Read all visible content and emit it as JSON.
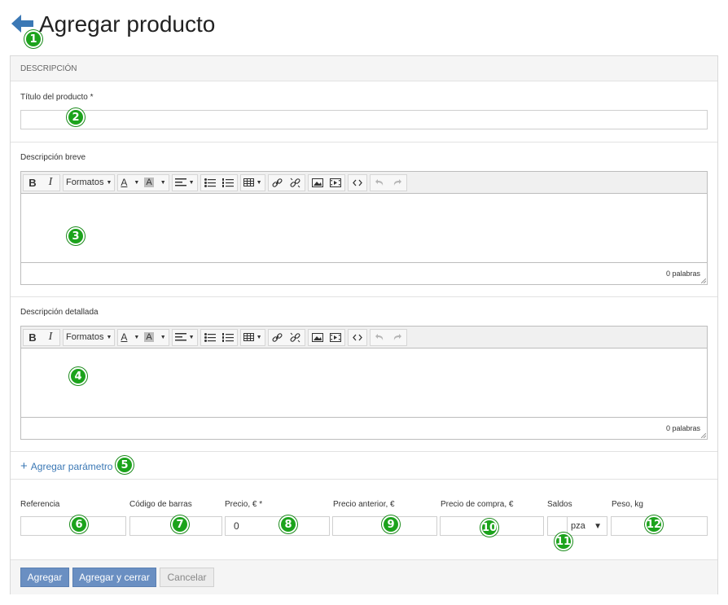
{
  "header": {
    "title": "Agregar producto"
  },
  "panel": {
    "heading": "DESCRIPCIÓN"
  },
  "product_title": {
    "label": "Título del producto *",
    "value": ""
  },
  "short_description": {
    "label": "Descripción breve",
    "word_count": "0 palabras"
  },
  "long_description": {
    "label": "Descripción detallada",
    "word_count": "0 palabras"
  },
  "toolbar": {
    "formats_label": "Formatos",
    "font_color_glyph": "A",
    "bg_color_glyph": "A"
  },
  "add_parameter": {
    "label": "Agregar parámetro"
  },
  "fields": {
    "reference": {
      "label": "Referencia",
      "value": ""
    },
    "barcode": {
      "label": "Código de barras",
      "value": ""
    },
    "price": {
      "label": "Precio, € *",
      "value": "0"
    },
    "old_price": {
      "label": "Precio anterior, €",
      "value": ""
    },
    "purchase_price": {
      "label": "Precio de compra, €",
      "value": ""
    },
    "stock": {
      "label": "Saldos",
      "value": "",
      "unit": "pza"
    },
    "weight": {
      "label": "Peso, kg",
      "value": ""
    }
  },
  "buttons": {
    "add": "Agregar",
    "add_close": "Agregar y cerrar",
    "cancel": "Cancelar"
  },
  "markers": [
    "1",
    "2",
    "3",
    "4",
    "5",
    "6",
    "7",
    "8",
    "9",
    "10",
    "11",
    "12"
  ],
  "colors": {
    "accent": "#3b78b5",
    "primary_button": "#6a8fc2",
    "marker": "#1ca31c"
  }
}
